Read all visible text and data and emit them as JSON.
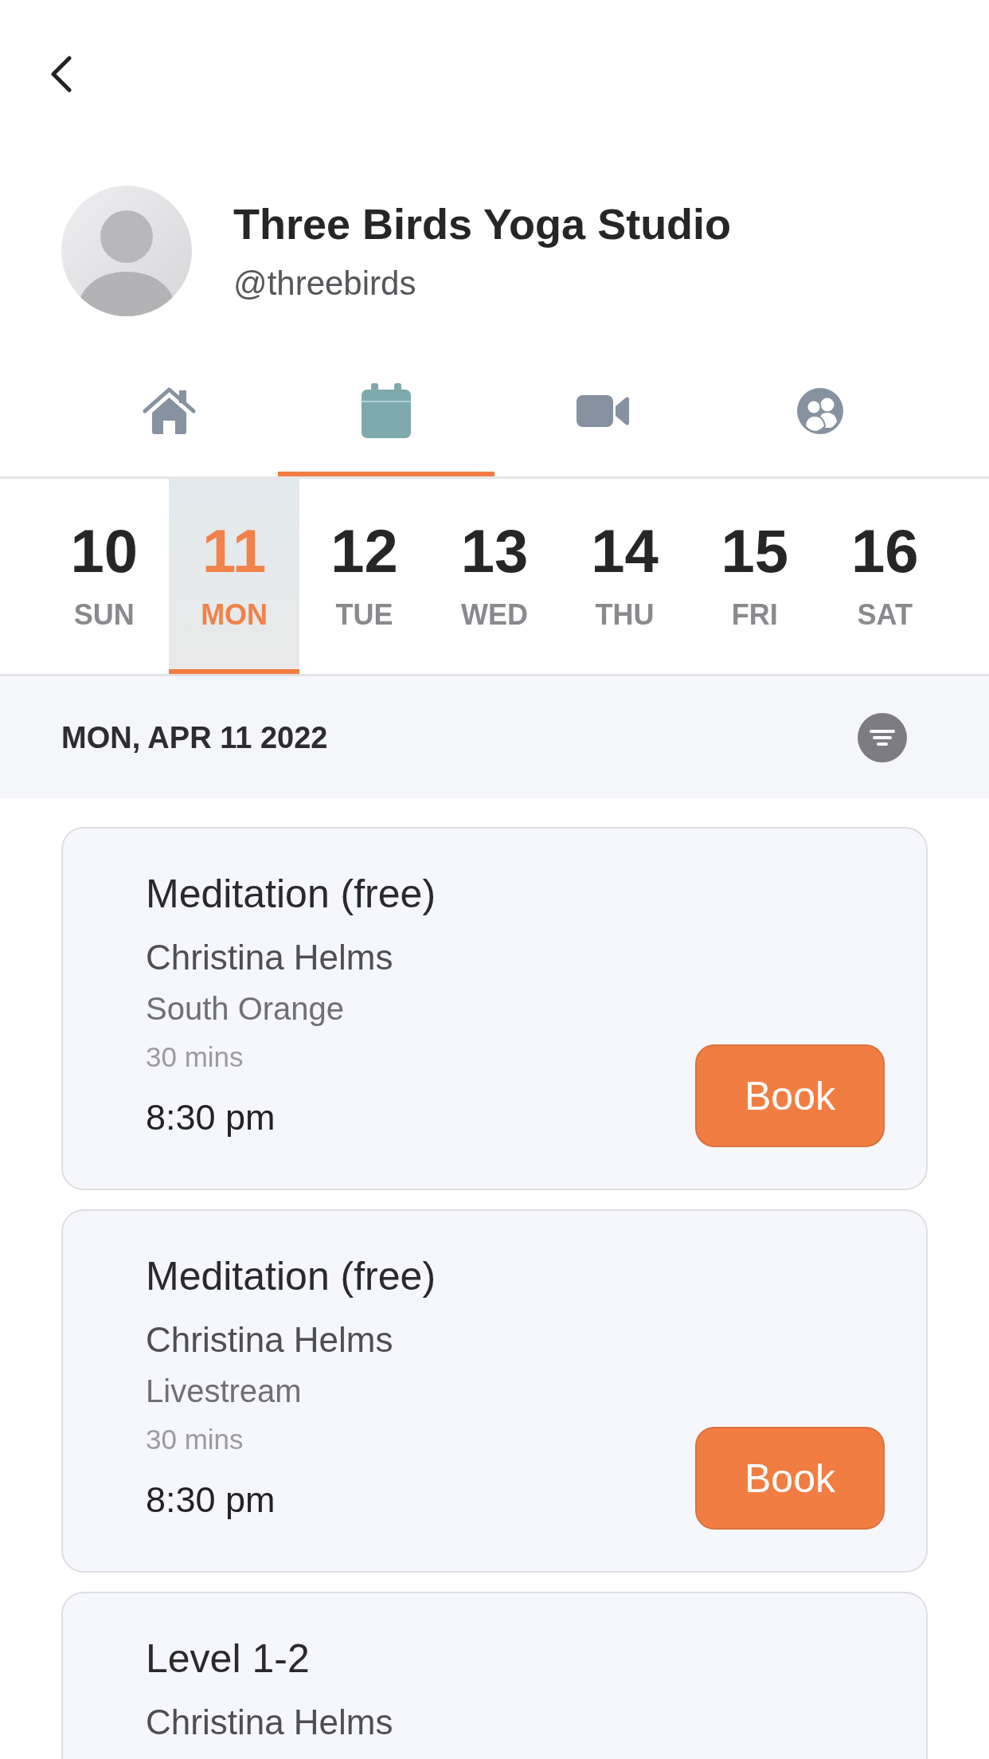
{
  "profile": {
    "name": "Three Birds Yoga Studio",
    "handle": "@threebirds"
  },
  "tabs": [
    {
      "kind": "home",
      "selected": false
    },
    {
      "kind": "calendar",
      "selected": true
    },
    {
      "kind": "video",
      "selected": false
    },
    {
      "kind": "people",
      "selected": false
    }
  ],
  "days": [
    {
      "date": "10",
      "weekday": "SUN",
      "selected": false
    },
    {
      "date": "11",
      "weekday": "MON",
      "selected": true
    },
    {
      "date": "12",
      "weekday": "TUE",
      "selected": false
    },
    {
      "date": "13",
      "weekday": "WED",
      "selected": false
    },
    {
      "date": "14",
      "weekday": "THU",
      "selected": false
    },
    {
      "date": "15",
      "weekday": "FRI",
      "selected": false
    },
    {
      "date": "16",
      "weekday": "SAT",
      "selected": false
    }
  ],
  "date_header": {
    "label": "MON, APR 11 2022"
  },
  "classes": [
    {
      "title": "Meditation (free)",
      "instructor": "Christina Helms",
      "location": "South Orange",
      "duration": "30 mins",
      "time": "8:30 pm",
      "button": "Book"
    },
    {
      "title": "Meditation (free)",
      "instructor": "Christina Helms",
      "location": "Livestream",
      "duration": "30 mins",
      "time": "8:30 pm",
      "button": "Book"
    },
    {
      "title": "Level 1-2",
      "instructor": "Christina Helms"
    }
  ]
}
